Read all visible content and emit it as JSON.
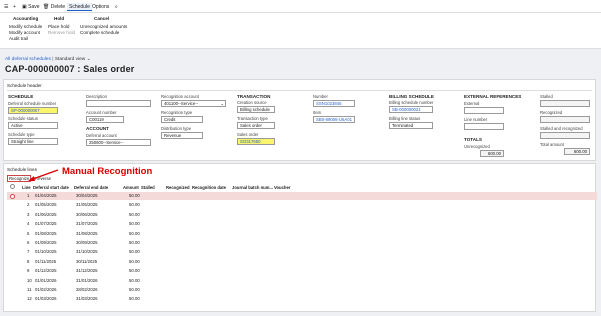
{
  "toolbar": {
    "save": "Save",
    "delete": "Delete",
    "schedule": "Schedule",
    "options": "Options"
  },
  "ribbon": {
    "accounting_head": "Accounting",
    "modify_schedule": "Modify schedule",
    "modify_account": "Modify account",
    "audit_trail": "Audit trail",
    "hold_head": "Hold",
    "place_hold": "Place hold",
    "remove_hold": "Remove hold",
    "cancel_head": "Cancel",
    "unrecognized": "Unrecognized amounts",
    "complete_schedule": "Complete schedule"
  },
  "breadcrumb": {
    "link": "All deferral schedules",
    "sep": "|",
    "view": "Standard view"
  },
  "page_title": "CAP-000000007 : Sales order",
  "header": {
    "title": "Schedule header",
    "schedule_head": "SCHEDULE",
    "deferral_no_label": "Deferral schedule number",
    "deferral_no": "SP-000000007",
    "status_label": "Schedule status",
    "status": "Active",
    "type_label": "Schedule type",
    "type": "Straight line",
    "description_label": "Description",
    "description": "",
    "account_no_label": "Account number",
    "account_no": "C00119",
    "account_head": "ACCOUNT",
    "deferral_account_label": "Deferral account",
    "deferral_account": "250600--Service--",
    "rec_account_label": "Recognition account",
    "rec_account": "401100--Service--",
    "rec_type_label": "Recognition type",
    "rec_type": "Credit",
    "dist_type_label": "Distribution type",
    "dist_type": "Revenue",
    "transaction_head": "TRANSACTION",
    "creation_source_label": "Creation source",
    "creation_source": "Billing schedule",
    "trans_type_label": "Transaction type",
    "trans_type": "Sales order",
    "sales_order_label": "Sales order",
    "sales_order": "SO317650",
    "number_label": "Number",
    "number": "SSN1023845",
    "item_label": "Item",
    "item": "SB0-89006-U6A01",
    "billing_head": "BILLING SCHEDULE",
    "billing_no_label": "Billing schedule number",
    "billing_no": "SB-000000021",
    "billing_status_label": "Billing line status",
    "billing_status": "Terminated",
    "external_head": "EXTERNAL REFERENCES",
    "external_label": "External",
    "external": "",
    "line_no_label": "Line number",
    "line_no": "",
    "totals_head": "TOTALS",
    "unrecognized_label": "Unrecognized",
    "unrecognized": "600.00",
    "stalled_label": "Stalled",
    "stalled": "",
    "recognized_label": "Recognized",
    "recognized": "",
    "stalled_rec_label": "Stalled and recognized",
    "stalled_rec": "",
    "total_label": "Total amount",
    "total": "600.00"
  },
  "lines": {
    "title": "Schedule lines",
    "annotation": "Manual Recognition",
    "btn_recognize": "Recognize",
    "btn_reverse": "Reverse",
    "columns": [
      "Line",
      "Deferral start date",
      "Deferral end date",
      "Amount",
      "Stalled",
      "Recognized",
      "Recognition date",
      "Journal batch num...",
      "Voucher"
    ],
    "rows": [
      {
        "line": "1",
        "start": "01/04/2025",
        "end": "30/04/2025",
        "amount": "50.00"
      },
      {
        "line": "2",
        "start": "01/05/2025",
        "end": "31/05/2025",
        "amount": "50.00"
      },
      {
        "line": "3",
        "start": "01/06/2025",
        "end": "30/06/2025",
        "amount": "50.00"
      },
      {
        "line": "4",
        "start": "01/07/2025",
        "end": "31/07/2025",
        "amount": "50.00"
      },
      {
        "line": "5",
        "start": "01/08/2025",
        "end": "31/08/2025",
        "amount": "50.00"
      },
      {
        "line": "6",
        "start": "01/09/2025",
        "end": "30/09/2025",
        "amount": "50.00"
      },
      {
        "line": "7",
        "start": "01/10/2025",
        "end": "31/10/2025",
        "amount": "50.00"
      },
      {
        "line": "8",
        "start": "01/11/2025",
        "end": "30/11/2025",
        "amount": "50.00"
      },
      {
        "line": "9",
        "start": "01/12/2025",
        "end": "31/12/2025",
        "amount": "50.00"
      },
      {
        "line": "10",
        "start": "01/01/2026",
        "end": "31/01/2026",
        "amount": "50.00"
      },
      {
        "line": "11",
        "start": "01/02/2026",
        "end": "28/02/2026",
        "amount": "50.00"
      },
      {
        "line": "12",
        "start": "01/03/2026",
        "end": "31/03/2026",
        "amount": "50.00"
      }
    ]
  },
  "colors": {
    "accent": "#1f5fbf",
    "annotation": "#d90000",
    "highlight": "#fbf56c",
    "selected_row": "#f5dada"
  }
}
